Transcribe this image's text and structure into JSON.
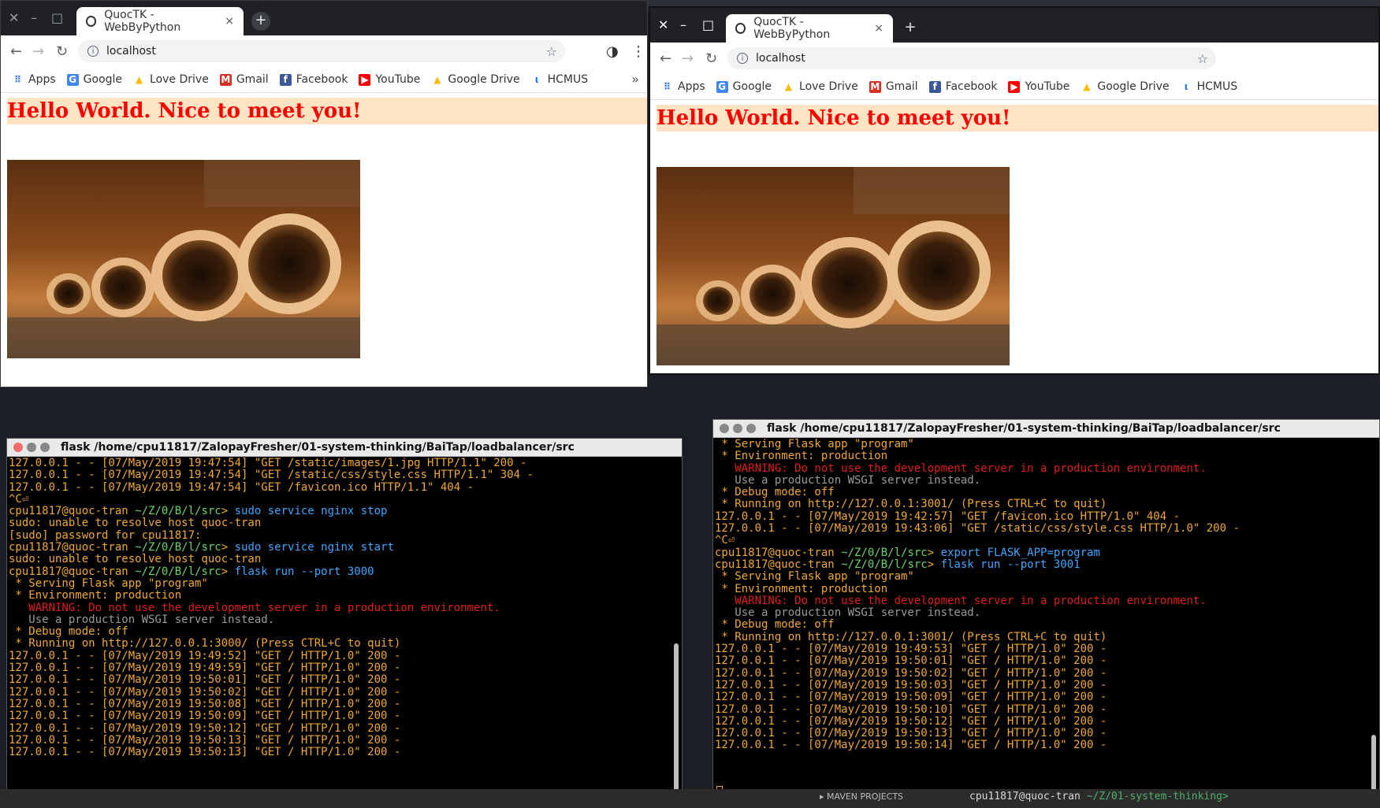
{
  "browser_left": {
    "tab_title": "QuocTK - WebByPython",
    "tab_close": "×",
    "new_tab": "+",
    "url": "localhost",
    "heading": "Hello World. Nice to meet you!"
  },
  "browser_right": {
    "tab_title": "QuocTK - WebByPython",
    "tab_close": "×",
    "new_tab": "+",
    "url": "localhost",
    "heading": "Hello World. Nice to meet you!"
  },
  "bookmarks": [
    {
      "label": "Apps",
      "icon": "apps-grid-icon"
    },
    {
      "label": "Google",
      "icon": "google-icon"
    },
    {
      "label": "Love Drive",
      "icon": "drive-icon"
    },
    {
      "label": "Gmail",
      "icon": "gmail-icon"
    },
    {
      "label": "Facebook",
      "icon": "facebook-icon"
    },
    {
      "label": "YouTube",
      "icon": "youtube-icon"
    },
    {
      "label": "Google Drive",
      "icon": "drive-icon"
    },
    {
      "label": "HCMUS",
      "icon": "hcmus-icon"
    }
  ],
  "bookmarks_overflow": "»",
  "terminal_left": {
    "title": "flask  /home/cpu11817/ZalopayFresher/01-system-thinking/BaiTap/loadbalancer/src",
    "lines": [
      [
        {
          "t": "127.0.0.1 - - [07/May/2019 19:47:54] \"GET /static/images/1.jpg HTTP/1.1\" 200 -",
          "c": "o"
        }
      ],
      [
        {
          "t": "127.0.0.1 - - [07/May/2019 19:47:54] \"GET /static/css/style.css HTTP/1.1\" 304 -",
          "c": "o"
        }
      ],
      [
        {
          "t": "127.0.0.1 - - [07/May/2019 19:47:54] \"GET /favicon.ico HTTP/1.1\" 404 -",
          "c": "o"
        }
      ],
      [
        {
          "t": "^C⏎",
          "c": "o"
        }
      ],
      [
        {
          "t": "cpu11817@quoc-tran ",
          "c": "o"
        },
        {
          "t": "~/Z/0/B/l/src",
          "c": "g"
        },
        {
          "t": "> ",
          "c": "o"
        },
        {
          "t": "sudo service nginx stop",
          "c": "b"
        }
      ],
      [
        {
          "t": "sudo: unable to resolve host quoc-tran",
          "c": "o"
        }
      ],
      [
        {
          "t": "[sudo] password for cpu11817:",
          "c": "o"
        }
      ],
      [
        {
          "t": "cpu11817@quoc-tran ",
          "c": "o"
        },
        {
          "t": "~/Z/0/B/l/src",
          "c": "g"
        },
        {
          "t": "> ",
          "c": "o"
        },
        {
          "t": "sudo service nginx start",
          "c": "b"
        }
      ],
      [
        {
          "t": "sudo: unable to resolve host quoc-tran",
          "c": "o"
        }
      ],
      [
        {
          "t": "cpu11817@quoc-tran ",
          "c": "o"
        },
        {
          "t": "~/Z/0/B/l/src",
          "c": "g"
        },
        {
          "t": "> ",
          "c": "o"
        },
        {
          "t": "flask run --port 3000",
          "c": "b"
        }
      ],
      [
        {
          "t": " * Serving Flask app \"program\"",
          "c": "o"
        }
      ],
      [
        {
          "t": " * Environment: production",
          "c": "o"
        }
      ],
      [
        {
          "t": "   WARNING: Do not use the development server in a production environment.",
          "c": "r"
        }
      ],
      [
        {
          "t": "   Use a production WSGI server instead.",
          "c": "y"
        }
      ],
      [
        {
          "t": " * Debug mode: off",
          "c": "o"
        }
      ],
      [
        {
          "t": " * Running on http://127.0.0.1:3000/ (Press CTRL+C to quit)",
          "c": "o"
        }
      ],
      [
        {
          "t": "127.0.0.1 - - [07/May/2019 19:49:52] \"GET / HTTP/1.0\" 200 -",
          "c": "o"
        }
      ],
      [
        {
          "t": "127.0.0.1 - - [07/May/2019 19:49:59] \"GET / HTTP/1.0\" 200 -",
          "c": "o"
        }
      ],
      [
        {
          "t": "127.0.0.1 - - [07/May/2019 19:50:01] \"GET / HTTP/1.0\" 200 -",
          "c": "o"
        }
      ],
      [
        {
          "t": "127.0.0.1 - - [07/May/2019 19:50:02] \"GET / HTTP/1.0\" 200 -",
          "c": "o"
        }
      ],
      [
        {
          "t": "127.0.0.1 - - [07/May/2019 19:50:08] \"GET / HTTP/1.0\" 200 -",
          "c": "o"
        }
      ],
      [
        {
          "t": "127.0.0.1 - - [07/May/2019 19:50:09] \"GET / HTTP/1.0\" 200 -",
          "c": "o"
        }
      ],
      [
        {
          "t": "127.0.0.1 - - [07/May/2019 19:50:12] \"GET / HTTP/1.0\" 200 -",
          "c": "o"
        }
      ],
      [
        {
          "t": "127.0.0.1 - - [07/May/2019 19:50:13] \"GET / HTTP/1.0\" 200 -",
          "c": "o"
        }
      ],
      [
        {
          "t": "127.0.0.1 - - [07/May/2019 19:50:13] \"GET / HTTP/1.0\" 200 -",
          "c": "o"
        }
      ]
    ]
  },
  "terminal_right": {
    "title": "flask  /home/cpu11817/ZalopayFresher/01-system-thinking/BaiTap/loadbalancer/src",
    "lines": [
      [
        {
          "t": " * Serving Flask app \"program\"",
          "c": "o"
        }
      ],
      [
        {
          "t": " * Environment: production",
          "c": "o"
        }
      ],
      [
        {
          "t": "   WARNING: Do not use the development server in a production environment.",
          "c": "r"
        }
      ],
      [
        {
          "t": "   Use a production WSGI server instead.",
          "c": "y"
        }
      ],
      [
        {
          "t": " * Debug mode: off",
          "c": "o"
        }
      ],
      [
        {
          "t": " * Running on http://127.0.0.1:3001/ (Press CTRL+C to quit)",
          "c": "o"
        }
      ],
      [
        {
          "t": "127.0.0.1 - - [07/May/2019 19:42:57] \"GET /favicon.ico HTTP/1.0\" 404 -",
          "c": "o"
        }
      ],
      [
        {
          "t": "127.0.0.1 - - [07/May/2019 19:43:06] \"GET /static/css/style.css HTTP/1.0\" 200 -",
          "c": "o"
        }
      ],
      [
        {
          "t": "^C⏎",
          "c": "o"
        }
      ],
      [
        {
          "t": "cpu11817@quoc-tran ",
          "c": "o"
        },
        {
          "t": "~/Z/0/B/l/src",
          "c": "g"
        },
        {
          "t": "> ",
          "c": "o"
        },
        {
          "t": "export FLASK_APP=program",
          "c": "b"
        }
      ],
      [
        {
          "t": "cpu11817@quoc-tran ",
          "c": "o"
        },
        {
          "t": "~/Z/0/B/l/src",
          "c": "g"
        },
        {
          "t": "> ",
          "c": "o"
        },
        {
          "t": "flask run --port 3001",
          "c": "b"
        }
      ],
      [
        {
          "t": " * Serving Flask app \"program\"",
          "c": "o"
        }
      ],
      [
        {
          "t": " * Environment: production",
          "c": "o"
        }
      ],
      [
        {
          "t": "   WARNING: Do not use the development server in a production environment.",
          "c": "r"
        }
      ],
      [
        {
          "t": "   Use a production WSGI server instead.",
          "c": "y"
        }
      ],
      [
        {
          "t": " * Debug mode: off",
          "c": "o"
        }
      ],
      [
        {
          "t": " * Running on http://127.0.0.1:3001/ (Press CTRL+C to quit)",
          "c": "o"
        }
      ],
      [
        {
          "t": "127.0.0.1 - - [07/May/2019 19:49:53] \"GET / HTTP/1.0\" 200 -",
          "c": "o"
        }
      ],
      [
        {
          "t": "127.0.0.1 - - [07/May/2019 19:50:01] \"GET / HTTP/1.0\" 200 -",
          "c": "o"
        }
      ],
      [
        {
          "t": "127.0.0.1 - - [07/May/2019 19:50:02] \"GET / HTTP/1.0\" 200 -",
          "c": "o"
        }
      ],
      [
        {
          "t": "127.0.0.1 - - [07/May/2019 19:50:03] \"GET / HTTP/1.0\" 200 -",
          "c": "o"
        }
      ],
      [
        {
          "t": "127.0.0.1 - - [07/May/2019 19:50:09] \"GET / HTTP/1.0\" 200 -",
          "c": "o"
        }
      ],
      [
        {
          "t": "127.0.0.1 - - [07/May/2019 19:50:10] \"GET / HTTP/1.0\" 200 -",
          "c": "o"
        }
      ],
      [
        {
          "t": "127.0.0.1 - - [07/May/2019 19:50:12] \"GET / HTTP/1.0\" 200 -",
          "c": "o"
        }
      ],
      [
        {
          "t": "127.0.0.1 - - [07/May/2019 19:50:13] \"GET / HTTP/1.0\" 200 -",
          "c": "o"
        }
      ],
      [
        {
          "t": "127.0.0.1 - - [07/May/2019 19:50:14] \"GET / HTTP/1.0\" 200 -",
          "c": "o"
        }
      ]
    ]
  },
  "background": {
    "maven_label": "▸ MAVEN PROJECTS",
    "prompt_user": "cpu11817@quoc-tran ",
    "prompt_path": "~/Z/01-system-thinking>"
  },
  "colors": {
    "heading_bg": "#ffe4c4",
    "heading_text": "#ff0000",
    "term_text": "#f0a830",
    "term_path": "#6ad36a",
    "term_cmd": "#3fa6ff",
    "term_warning": "#e01b1b"
  }
}
